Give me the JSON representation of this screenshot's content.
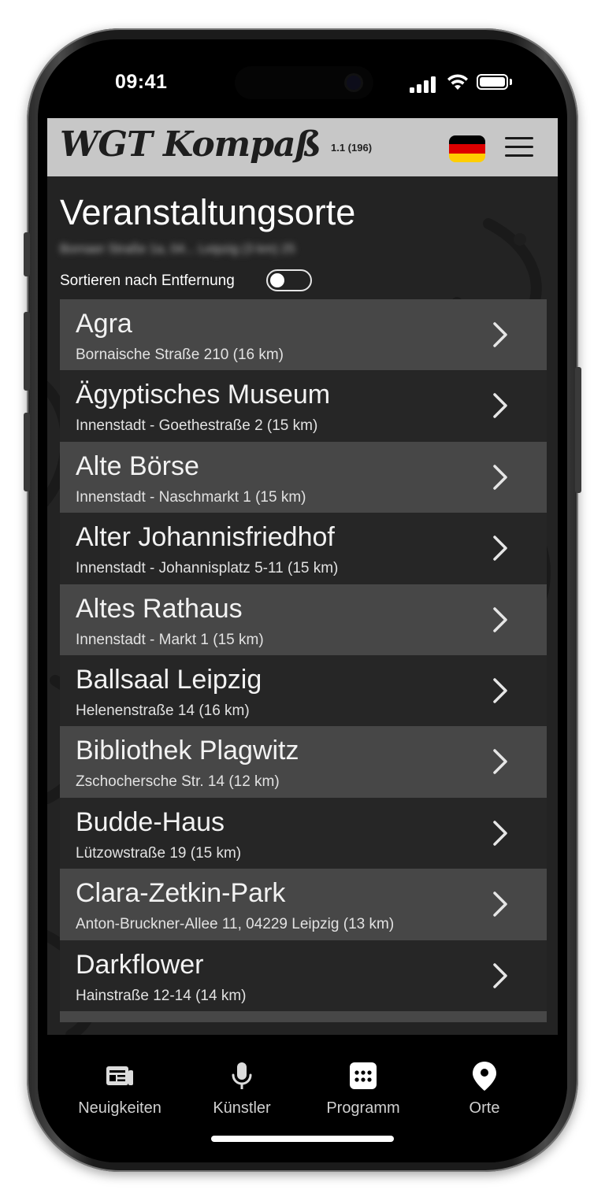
{
  "status_bar": {
    "time": "09:41"
  },
  "header": {
    "logo": "WGT Kompaß",
    "version": "1.1 (196)",
    "flag_colors": [
      "#000000",
      "#dd0000",
      "#ffce00"
    ],
    "menu_icon": "hamburger-menu-icon"
  },
  "page": {
    "title": "Veranstaltungsorte",
    "location_blurred": "Bornaer Straße 1a, 04... Leipzig (3 km) 25",
    "sort_label": "Sortieren nach Entfernung",
    "sort_enabled": false
  },
  "venues": [
    {
      "name": "Agra",
      "address": "Bornaische Straße 210 (16 km)"
    },
    {
      "name": "Ägyptisches Museum",
      "address": "Innenstadt - Goethestraße 2 (15 km)"
    },
    {
      "name": "Alte Börse",
      "address": "Innenstadt - Naschmarkt 1 (15 km)"
    },
    {
      "name": "Alter Johannisfriedhof",
      "address": "Innenstadt - Johannisplatz 5-11 (15 km)"
    },
    {
      "name": "Altes Rathaus",
      "address": "Innenstadt - Markt 1 (15 km)"
    },
    {
      "name": "Ballsaal Leipzig",
      "address": "Helenenstraße 14 (16 km)"
    },
    {
      "name": "Bibliothek Plagwitz",
      "address": "Zschochersche Str. 14 (12 km)"
    },
    {
      "name": "Budde-Haus",
      "address": "Lützowstraße 19 (15 km)"
    },
    {
      "name": "Clara-Zetkin-Park",
      "address": "Anton-Bruckner-Allee 11, 04229 Leipzig (13 km)"
    },
    {
      "name": "Darkflower",
      "address": "Hainstraße 12-14 (14 km)"
    }
  ],
  "tabs": [
    {
      "label": "Neuigkeiten",
      "icon": "newspaper-icon"
    },
    {
      "label": "Künstler",
      "icon": "microphone-icon"
    },
    {
      "label": "Programm",
      "icon": "calendar-grid-icon"
    },
    {
      "label": "Orte",
      "icon": "map-pin-icon",
      "active": true
    }
  ]
}
